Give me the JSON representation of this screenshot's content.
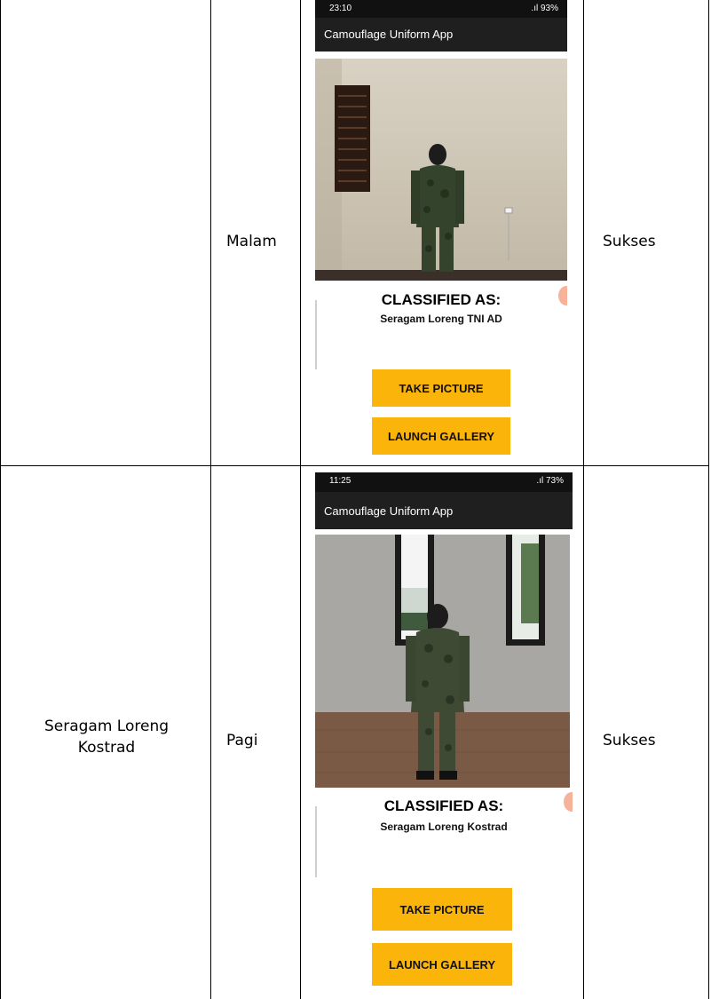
{
  "rows": [
    {
      "label": "",
      "time": "Malam",
      "result": "Sukses",
      "screenshot": {
        "status_time": "23:10",
        "status_right": ".ıl 93%",
        "app_title": "Camouflage Uniform App",
        "classified_label": "CLASSIFIED AS:",
        "classified_value": "Seragam Loreng TNI AD",
        "take_picture": "TAKE PICTURE",
        "launch_gallery": "LAUNCH GALLERY"
      }
    },
    {
      "label": "Seragam Loreng Kostrad",
      "time": "Pagi",
      "result": "Sukses",
      "screenshot": {
        "status_time": "11:25",
        "status_right": ".ıl 73%",
        "app_title": "Camouflage Uniform App",
        "classified_label": "CLASSIFIED AS:",
        "classified_value": "Seragam Loreng Kostrad",
        "take_picture": "TAKE PICTURE",
        "launch_gallery": "LAUNCH GALLERY"
      }
    }
  ],
  "colors": {
    "button": "#fbb40a",
    "appbar": "#1f1f1f",
    "statusbar": "#111111"
  }
}
